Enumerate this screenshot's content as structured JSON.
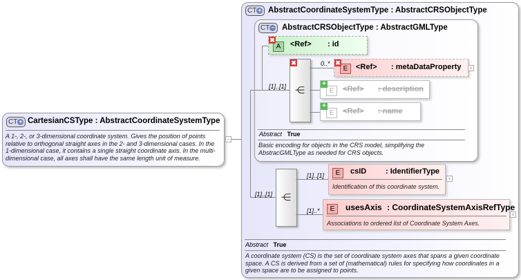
{
  "root": {
    "badge": "CT",
    "name": "CartesianCSType",
    "sep": ":",
    "base": "AbstractCoordinateSystemType",
    "description": "A 1-, 2-, or 3-dimensional coordinate system. Gives the position of points relative to orthogonal straight axes in the 2- and 3-dimensional cases. In the 1-dimensional case, it contains a single straight coordinate axis. In the multi-dimensional case, all axes shall have the same length unit of measure.",
    "collapse": "−"
  },
  "outer": {
    "badge": "CT",
    "title": "AbstractCoordinateSystemType : AbstractCRSObjectType",
    "abstract_label": "Abstract",
    "abstract_value": "True",
    "description": "A coordinate system (CS) is the set of coordinate system axes that spans a given coordinate space. A CS is derived from a set of (mathematical) rules for specifying how coordinates in a given space are to be assigned to points.",
    "seq_mult": "[1]..[1]",
    "elements": [
      {
        "badge": "E",
        "name": "csID",
        "type": ": IdentifierType",
        "mult": "[1]..[1]",
        "description": "Identification of this coordinate system."
      },
      {
        "badge": "E",
        "name": "usesAxis",
        "type": ": CoordinateSystemAxisRefType",
        "mult": "[1]..*",
        "description": "Associations to ordered list of Coordinate System Axes."
      }
    ]
  },
  "inner": {
    "badge": "CT",
    "title": "AbstractCRSObjectType : AbstractGMLType",
    "abstract_label": "Abstract",
    "abstract_value": "True",
    "description": "Basic encoding for objects in the CRS model, simplifying the AbstracGMLType as needed for CRS objects.",
    "seq_mult": "[1]..[1]",
    "attribute": {
      "badge": "A",
      "ref": "<Ref>",
      "name": ": id"
    },
    "elements": [
      {
        "badge": "E",
        "ref": "<Ref>",
        "name": ": metaDataProperty",
        "mult": "0..*"
      },
      {
        "badge": "E",
        "ref": "<Ref>",
        "name": ": description"
      },
      {
        "badge": "E",
        "ref": "<Ref>",
        "name": ": name"
      }
    ]
  }
}
